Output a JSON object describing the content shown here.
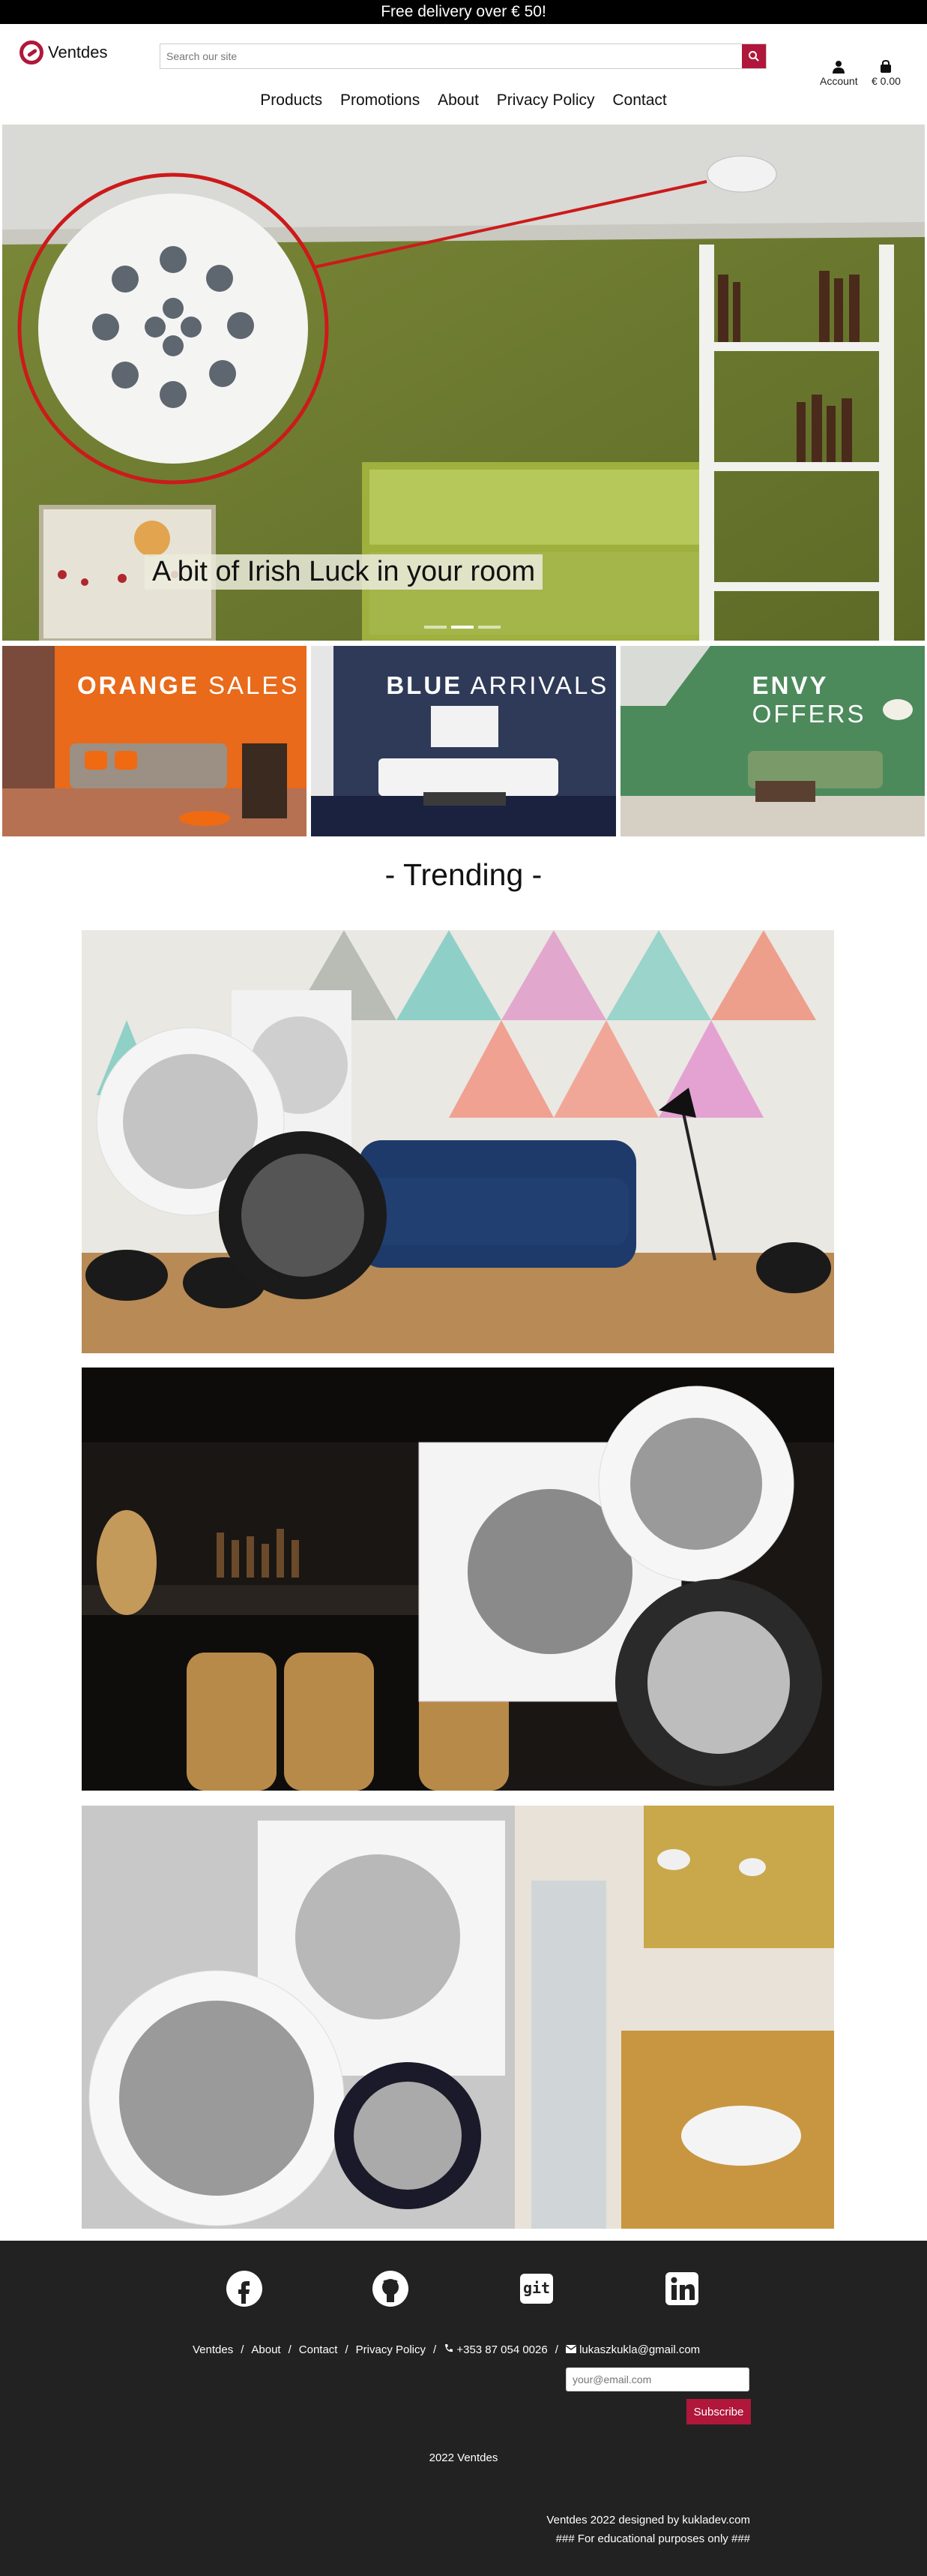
{
  "banner": {
    "text": "Free delivery over € 50!"
  },
  "header": {
    "logo_text": "Ventdes",
    "search_placeholder": "Search our site",
    "account_label": "Account",
    "bag_total": "€ 0.00",
    "icons": {
      "search": "search-icon",
      "account": "user-icon",
      "bag": "shopping-bag-icon"
    },
    "accent_color": "#b0173b"
  },
  "nav": {
    "items": [
      "Products",
      "Promotions",
      "About",
      "Privacy Policy",
      "Contact"
    ]
  },
  "hero": {
    "caption": "A bit of Irish Luck in your room",
    "slides": 3,
    "active_slide": 2
  },
  "promos": [
    {
      "bold": "ORANGE",
      "rest": "SALES"
    },
    {
      "bold": "BLUE",
      "rest": "ARRIVALS"
    },
    {
      "bold": "ENVY",
      "rest": "OFFERS"
    }
  ],
  "trending": {
    "title": "- Trending -"
  },
  "footer": {
    "socials": [
      "facebook-icon",
      "github-icon",
      "git-icon",
      "linkedin-icon"
    ],
    "git_text": "git",
    "links": [
      "Ventdes",
      "About",
      "Contact",
      "Privacy Policy"
    ],
    "separator": "/",
    "phone": "+353 87 054 0026",
    "email": "lukaszkukla@gmail.com",
    "email_placeholder": "your@email.com",
    "subscribe_label": "Subscribe",
    "copyright": "2022 Ventdes",
    "credit_line1": "Ventdes 2022 designed by kukladev.com",
    "credit_line2": "### For educational purposes only ###"
  }
}
